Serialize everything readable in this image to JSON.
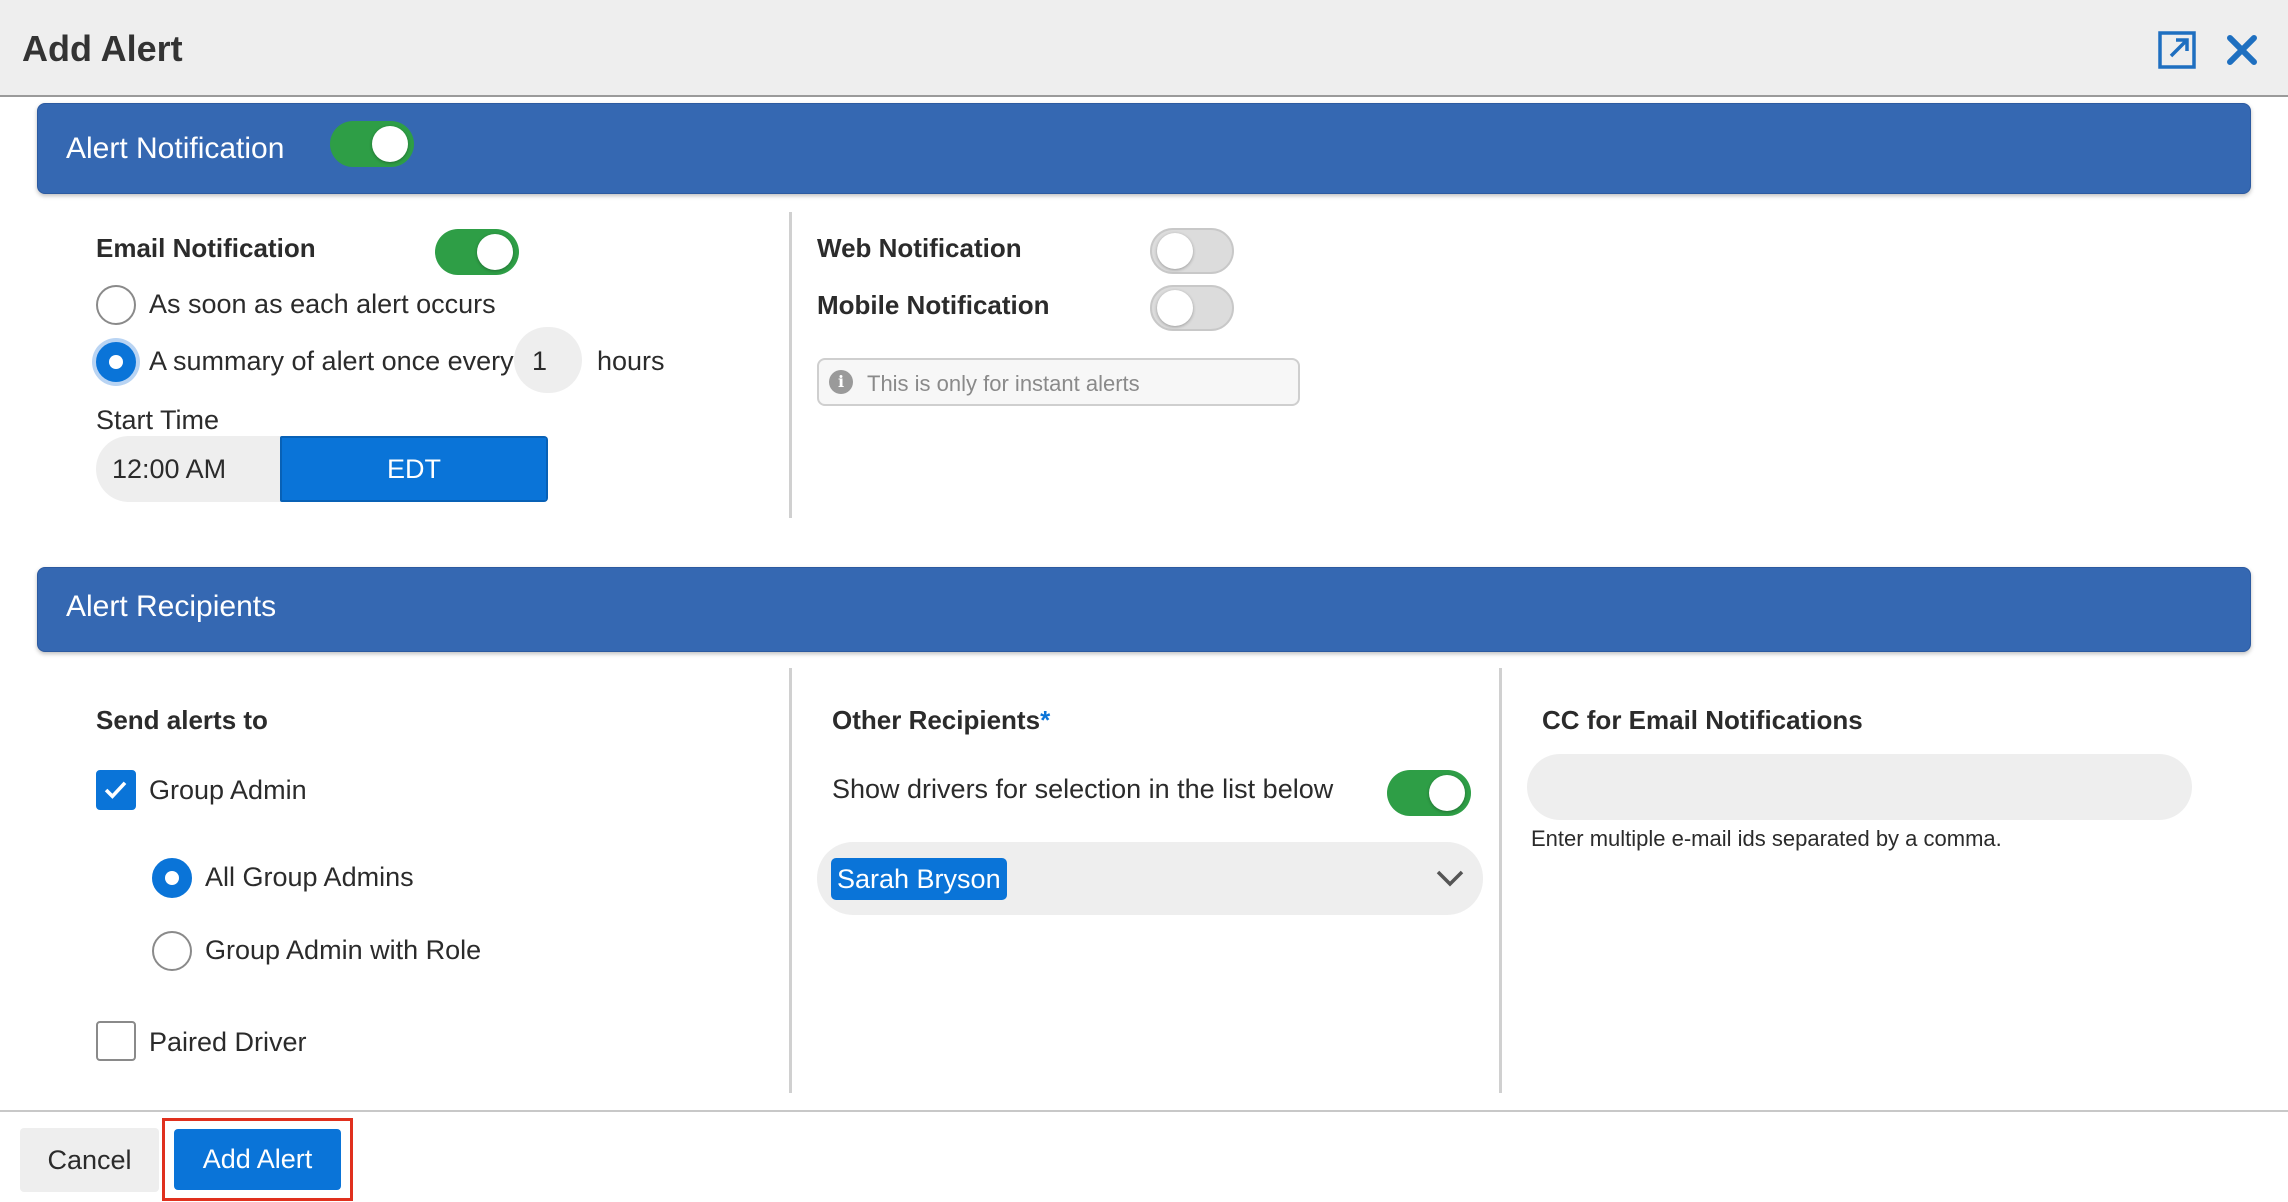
{
  "window": {
    "title": "Add Alert",
    "expand_icon": "expand-icon",
    "close_icon": "close-icon"
  },
  "alert_notification": {
    "title": "Alert Notification",
    "enabled": true,
    "email": {
      "label": "Email Notification",
      "enabled": true,
      "option_instant": "As soon as each alert occurs",
      "option_summary": "A summary of alert once every",
      "summary_selected": true,
      "hours_value": "1",
      "hours_unit": "hours",
      "start_time_label": "Start Time",
      "start_time_value": "12:00 AM",
      "timezone": "EDT"
    },
    "web": {
      "label": "Web Notification",
      "enabled": false
    },
    "mobile": {
      "label": "Mobile Notification",
      "enabled": false
    },
    "info_note": "This is only for instant alerts"
  },
  "alert_recipients": {
    "title": "Alert Recipients",
    "send_alerts_to": {
      "label": "Send alerts to",
      "group_admin": {
        "label": "Group Admin",
        "checked": true
      },
      "all_group_admins": {
        "label": "All Group Admins",
        "selected": true
      },
      "group_admin_with_role": {
        "label": "Group Admin with Role",
        "selected": false
      },
      "paired_driver": {
        "label": "Paired Driver",
        "checked": false
      }
    },
    "other_recipients": {
      "label": "Other Recipients",
      "required_mark": "*",
      "show_drivers_label": "Show drivers for selection in the list below",
      "show_drivers_enabled": true,
      "selected_tag": "Sarah Bryson"
    },
    "cc": {
      "label": "CC for Email Notifications",
      "value": "",
      "hint": "Enter multiple e-mail ids separated by a comma."
    }
  },
  "footer": {
    "cancel_label": "Cancel",
    "submit_label": "Add Alert"
  },
  "colors": {
    "banner": "#3568b2",
    "toggle_on": "#2e9e46",
    "primary": "#0a74d8",
    "highlight_border": "#e0301e"
  }
}
